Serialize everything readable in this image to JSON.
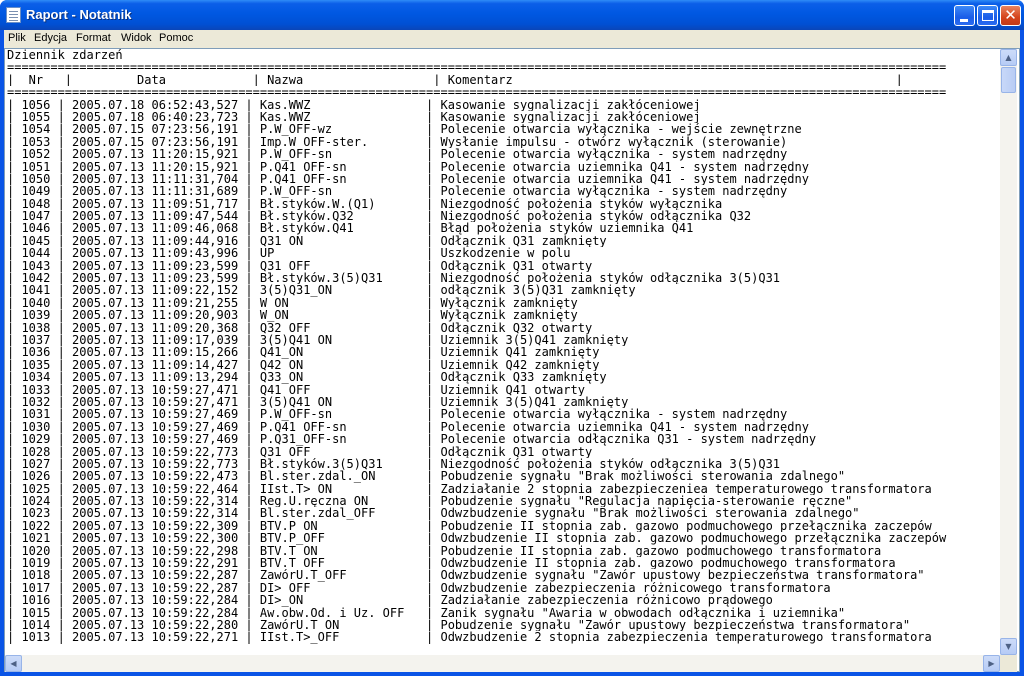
{
  "window": {
    "title": "Raport - Notatnik"
  },
  "menu": [
    "Plik",
    "Edycja",
    "Format",
    "Widok",
    "Pomoc"
  ],
  "header_lines": [
    "Dziennik zdarzeń",
    "==================================================================================================================================",
    "|  Nr   |         Data            | Nazwa                  | Komentarz                                                     |",
    "=================================================================================================================================="
  ],
  "rows": [
    [
      "1056",
      "2005.07.18 06:52:43,527",
      "Kas.WWZ",
      "Kasowanie sygnalizacji zakłóceniowej"
    ],
    [
      "1055",
      "2005.07.18 06:40:23,723",
      "Kas.WWZ",
      "Kasowanie sygnalizacji zakłóceniowej"
    ],
    [
      "1054",
      "2005.07.15 07:23:56,191",
      "P.W_OFF-wz",
      "Polecenie otwarcia wyłącznika - wejście zewnętrzne"
    ],
    [
      "1053",
      "2005.07.15 07:23:56,191",
      "Imp.W_OFF-ster.",
      "Wysłanie impulsu - otwórz wyłącznik (sterowanie)"
    ],
    [
      "1052",
      "2005.07.13 11:20:15,921",
      "P.W_OFF-sn",
      "Polecenie otwarcia wyłącznika - system nadrzędny"
    ],
    [
      "1051",
      "2005.07.13 11:20:15,921",
      "P.Q41_OFF-sn",
      "Polecenie otwarcia uziemnika Q41 - system nadrzędny"
    ],
    [
      "1050",
      "2005.07.13 11:11:31,704",
      "P.Q41_OFF-sn",
      "Polecenie otwarcia uziemnika Q41 - system nadrzędny"
    ],
    [
      "1049",
      "2005.07.13 11:11:31,689",
      "P.W_OFF-sn",
      "Polecenie otwarcia wyłącznika - system nadrzędny"
    ],
    [
      "1048",
      "2005.07.13 11:09:51,717",
      "Bł.styków.W.(Q1)",
      "Niezgodność położenia styków wyłącznika"
    ],
    [
      "1047",
      "2005.07.13 11:09:47,544",
      "Bł.styków.Q32",
      "Niezgodność położenia styków odłącznika Q32"
    ],
    [
      "1046",
      "2005.07.13 11:09:46,068",
      "Bł.styków.Q41",
      "Błąd położenia styków uziemnika Q41"
    ],
    [
      "1045",
      "2005.07.13 11:09:44,916",
      "Q31_ON",
      "Odłącznik Q31 zamknięty"
    ],
    [
      "1044",
      "2005.07.13 11:09:43,996",
      "UP",
      "Uszkodzenie w polu"
    ],
    [
      "1043",
      "2005.07.13 11:09:23,599",
      "Q31_OFF",
      "Odłącznik Q31 otwarty"
    ],
    [
      "1042",
      "2005.07.13 11:09:23,599",
      "Bł.styków.3(5)Q31",
      "Niezgodność położenia styków odłącznika 3(5)Q31"
    ],
    [
      "1041",
      "2005.07.13 11:09:22,152",
      "3(5)Q31_ON",
      "odłącznik 3(5)Q31 zamknięty"
    ],
    [
      "1040",
      "2005.07.13 11:09:21,255",
      "W_ON",
      "Wyłącznik zamknięty"
    ],
    [
      "1039",
      "2005.07.13 11:09:20,903",
      "W_ON",
      "Wyłącznik zamknięty"
    ],
    [
      "1038",
      "2005.07.13 11:09:20,368",
      "Q32_OFF",
      "Odłącznik Q32 otwarty"
    ],
    [
      "1037",
      "2005.07.13 11:09:17,039",
      "3(5)Q41_ON",
      "Uziemnik 3(5)Q41 zamknięty"
    ],
    [
      "1036",
      "2005.07.13 11:09:15,266",
      "Q41_ON",
      "Uziemnik Q41 zamknięty"
    ],
    [
      "1035",
      "2005.07.13 11:09:14,427",
      "Q42_ON",
      "Uziemnik Q42 zamknięty"
    ],
    [
      "1034",
      "2005.07.13 11:09:13,294",
      "Q33_ON",
      "Odłącznik Q33 zamknięty"
    ],
    [
      "1033",
      "2005.07.13 10:59:27,471",
      "Q41_OFF",
      "Uziemnik Q41 otwarty"
    ],
    [
      "1032",
      "2005.07.13 10:59:27,471",
      "3(5)Q41_ON",
      "Uziemnik 3(5)Q41 zamknięty"
    ],
    [
      "1031",
      "2005.07.13 10:59:27,469",
      "P.W_OFF-sn",
      "Polecenie otwarcia wyłącznika - system nadrzędny"
    ],
    [
      "1030",
      "2005.07.13 10:59:27,469",
      "P.Q41_OFF-sn",
      "Polecenie otwarcia uziemnika Q41 - system nadrzędny"
    ],
    [
      "1029",
      "2005.07.13 10:59:27,469",
      "P.Q31_OFF-sn",
      "Polecenie otwarcia odłącznika Q31 - system nadrzędny"
    ],
    [
      "1028",
      "2005.07.13 10:59:22,773",
      "Q31_OFF",
      "Odłącznik Q31 otwarty"
    ],
    [
      "1027",
      "2005.07.13 10:59:22,773",
      "Bł.styków.3(5)Q31",
      "Niezgodność położenia styków odłącznika 3(5)Q31"
    ],
    [
      "1026",
      "2005.07.13 10:59:22,473",
      "Bl.ster.zdal._ON",
      "Pobudzenie sygnału \"Brak możliwości sterowania zdalnego\""
    ],
    [
      "1025",
      "2005.07.13 10:59:22,464",
      "IIst.T>_ON",
      "Zadziałanie 2 stopnia zabezpieczeniea temperaturowego transformatora"
    ],
    [
      "1024",
      "2005.07.13 10:59:22,314",
      "Reg.U.ręczna_ON",
      "Pobudzenie sygnału \"Regulacja napięcia-sterowanie ręczne\""
    ],
    [
      "1023",
      "2005.07.13 10:59:22,314",
      "Bl.ster.zdal_OFF",
      "Odwzbudzenie sygnału \"Brak możliwości sterowania zdalnego\""
    ],
    [
      "1022",
      "2005.07.13 10:59:22,309",
      "BTV.P_ON",
      "Pobudzenie II stopnia zab. gazowo podmuchowego przełącznika zaczepów"
    ],
    [
      "1021",
      "2005.07.13 10:59:22,300",
      "BTV.P_OFF",
      "Odwzbudzenie II stopnia zab. gazowo podmuchowego przełącznika zaczepów"
    ],
    [
      "1020",
      "2005.07.13 10:59:22,298",
      "BTV.T_ON",
      "Pobudzenie II stopnia zab. gazowo podmuchowego transformatora"
    ],
    [
      "1019",
      "2005.07.13 10:59:22,291",
      "BTV.T_OFF",
      "Odwzbudzenie II stopnia zab. gazowo podmuchowego transformatora"
    ],
    [
      "1018",
      "2005.07.13 10:59:22,287",
      "ZawórU.T_OFF",
      "Odwzbudzenie sygnału \"Zawór upustowy bezpieczeństwa transformatora\""
    ],
    [
      "1017",
      "2005.07.13 10:59:22,287",
      "DI>_OFF",
      "Odwzbudzenie zabezpieczenia różnicowego transformatora"
    ],
    [
      "1016",
      "2005.07.13 10:59:22,284",
      "DI>_ON",
      "Zadziałanie zabezpieczenia różnicowo prądowego"
    ],
    [
      "1015",
      "2005.07.13 10:59:22,284",
      "Aw.obw.Od._i_Uz._OFF",
      "Zanik sygnału \"Awaria w obwodach odłącznika i uziemnika\""
    ],
    [
      "1014",
      "2005.07.13 10:59:22,280",
      "ZawórU.T_ON",
      "Pobudzenie sygnału \"Zawór upustowy bezpieczeństwa transformatora\""
    ],
    [
      "1013",
      "2005.07.13 10:59:22,271",
      "IIst.T>_OFF",
      "Odwzbudzenie 2 stopnia zabezpieczenia temperaturowego transformatora"
    ]
  ]
}
